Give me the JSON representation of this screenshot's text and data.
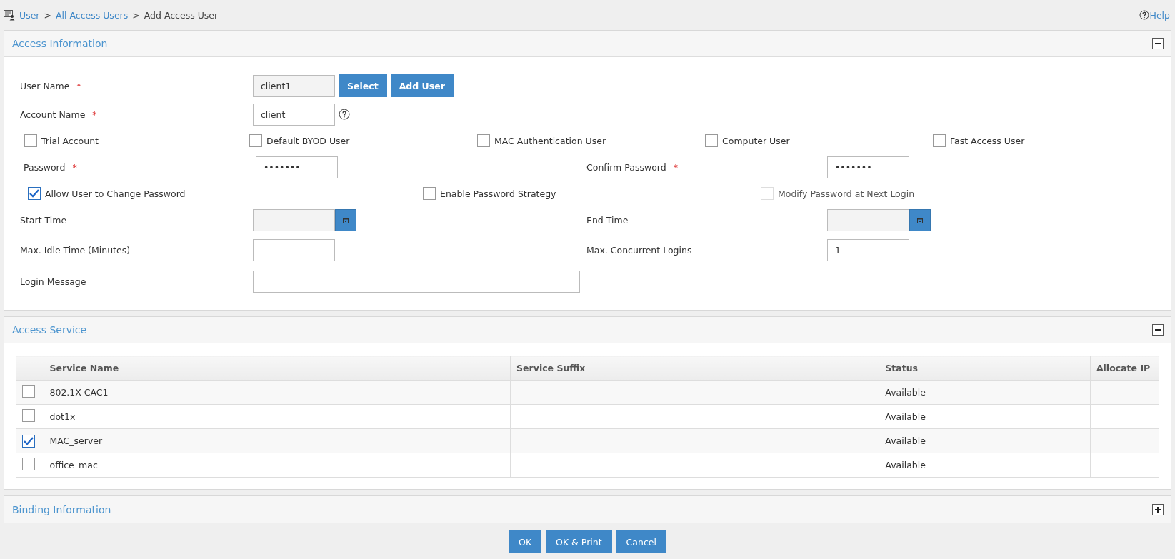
{
  "breadcrumb": [
    {
      "kind": "link",
      "text": "User"
    },
    {
      "kind": "sep",
      "text": ">"
    },
    {
      "kind": "link",
      "text": "All Access Users"
    },
    {
      "kind": "sep",
      "text": ">"
    },
    {
      "kind": "current",
      "text": "Add Access User"
    }
  ],
  "help": "Help",
  "access_info": {
    "title": "Access Information",
    "expanded": true,
    "user_name": {
      "label": "User Name",
      "mark": "*",
      "value": "client1",
      "disabled": true
    },
    "user_buttons": [
      "Select",
      "Add User"
    ],
    "account_name": {
      "label": "Account Name",
      "mark": "*",
      "value": "client"
    },
    "account_types": [
      {
        "label": "Trial Account",
        "checked": false
      },
      {
        "label": "Default BYOD User",
        "checked": false
      },
      {
        "label": "MAC Authentication User",
        "checked": false
      },
      {
        "label": "Computer User",
        "checked": false
      },
      {
        "label": "Fast Access User",
        "checked": false
      }
    ],
    "password": {
      "label": "Password",
      "mark": "*",
      "value": "•••••••"
    },
    "confirm_password": {
      "label": "Confirm Password",
      "mark": "*",
      "value": "•••••••"
    },
    "password_options": [
      {
        "label": "Allow User to Change Password",
        "checked": true,
        "disabled": false
      },
      {
        "label": "Enable Password Strategy",
        "checked": false,
        "disabled": false
      },
      {
        "label": "Modify Password at Next Login",
        "checked": false,
        "disabled": true
      }
    ],
    "start_time": {
      "label": "Start Time",
      "disabled": true
    },
    "end_time": {
      "label": "End Time",
      "disabled": true
    },
    "max_idle_time": {
      "label": "Max. Idle Time (Minutes)"
    },
    "max_concurrent_logins": {
      "label": "Max. Concurrent Logins",
      "value": "1"
    },
    "login_message": {
      "label": "Login Message"
    }
  },
  "access_service": {
    "title": "Access Service",
    "expanded": true,
    "columns": [
      "Service Name",
      "Service Suffix",
      "Status",
      "Allocate IP"
    ],
    "rows": [
      {
        "service_name": "802.1X-CAC1",
        "status": "Available",
        "checked": false
      },
      {
        "service_name": "dot1x",
        "status": "Available",
        "checked": false
      },
      {
        "service_name": "MAC_server",
        "status": "Available",
        "checked": true
      },
      {
        "service_name": "office_mac",
        "status": "Available",
        "checked": false
      }
    ]
  },
  "binding_info": {
    "title": "Binding Information",
    "expanded": false
  },
  "buttons": [
    "OK",
    "OK & Print",
    "Cancel"
  ]
}
